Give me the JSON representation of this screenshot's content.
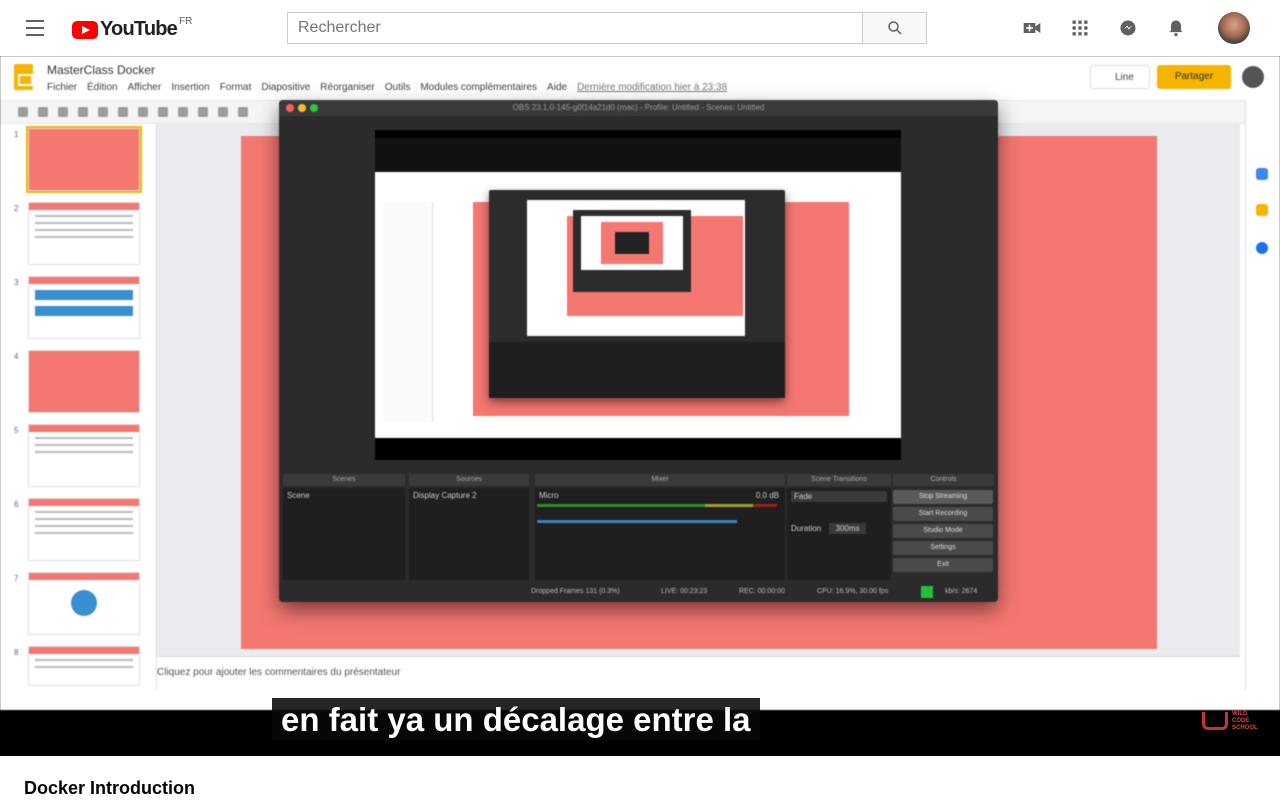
{
  "youtube": {
    "logo_text": "YouTube",
    "region": "FR",
    "search_placeholder": "Rechercher"
  },
  "slides_app": {
    "doc_title": "MasterClass Docker",
    "menus": [
      "Fichier",
      "Édition",
      "Afficher",
      "Insertion",
      "Format",
      "Diapositive",
      "Réorganiser",
      "Outils",
      "Modules complémentaires",
      "Aide"
    ],
    "last_edit": "Dernière modification hier à 23:38",
    "line_label": "Line",
    "share_label": "Partager",
    "speaker_notes": "Cliquez pour ajouter les commentaires du présentateur",
    "slide_numbers": [
      "1",
      "2",
      "3",
      "4",
      "5",
      "6",
      "7",
      "8"
    ]
  },
  "obs": {
    "window_title": "OBS 23.1.0-145-g0f14a21d0 (mac) - Profile: Untitled - Scenes: Untitled",
    "docks": [
      "Scenes",
      "Sources",
      "Mixer",
      "Scene Transitions",
      "Controls"
    ],
    "scene_item": "Scene",
    "source_item": "Display Capture 2",
    "mixer_track": "Micro",
    "mixer_db": "0.0 dB",
    "transition": "Fade",
    "duration_label": "Duration",
    "duration_value": "300ms",
    "controls": [
      "Stop Streaming",
      "Start Recording",
      "Studio Mode",
      "Settings",
      "Exit"
    ],
    "status": {
      "dropped": "Dropped Frames 131 (0.3%)",
      "live": "LIVE: 00:23:23",
      "rec": "REC: 00:00:00",
      "cpu": "CPU: 16.9%, 30.00 fps",
      "kbps": "kb/s: 2674"
    }
  },
  "caption": "en fait ya un décalage entre la",
  "watermark": "WILD CODE SCHOOL",
  "video_title": "Docker Introduction",
  "colors": {
    "youtube_red": "#ff0000",
    "slide_coral": "#f47771",
    "slides_yellow": "#f4b400",
    "obs_dark": "#2b2b2b"
  }
}
